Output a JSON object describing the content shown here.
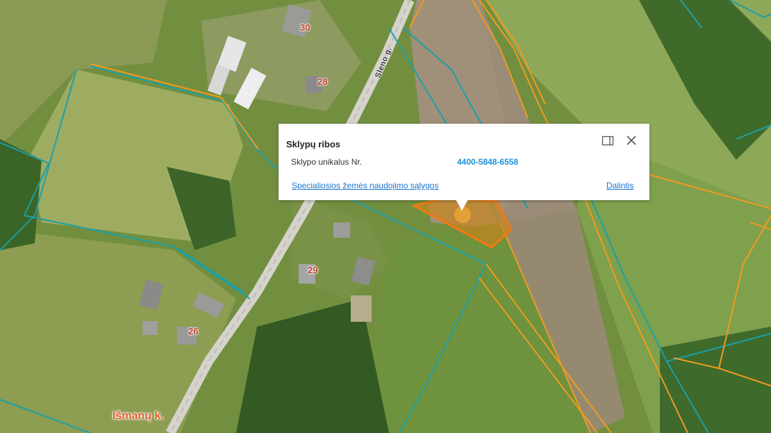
{
  "map": {
    "house_numbers": [
      "30",
      "28",
      "29",
      "26"
    ],
    "street_name": "Sleno g.",
    "village_name": "Išmanų k.",
    "colors": {
      "parcel_boundary": "#1aa0a8",
      "cadastral_boundary": "#f29a20",
      "selected_parcel_fill": "#c8851e",
      "selected_parcel_stroke": "#f07a10"
    }
  },
  "popup": {
    "title": "Sklypų ribos",
    "id_label": "Sklypo unikalus Nr.",
    "id_value": "4400-5848-6558",
    "conditions_link": "Specialiosios žemės naudojimo sąlygos",
    "share_link": "Dalintis",
    "icons": {
      "dock": "dock-panel-icon",
      "close": "close-icon"
    }
  }
}
